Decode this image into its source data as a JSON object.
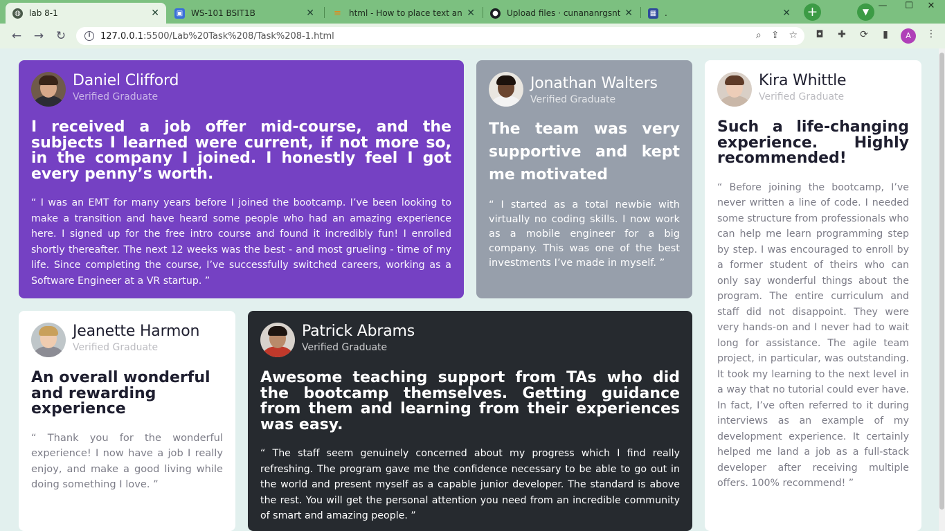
{
  "browser": {
    "tabs": [
      {
        "title": "lab 8-1",
        "active": true
      },
      {
        "title": "WS-101 BSIT1B"
      },
      {
        "title": "html - How to place text and"
      },
      {
        "title": "Upload files · cunananrgsnts"
      },
      {
        "title": "."
      }
    ],
    "new_tab_label": "+",
    "url_host": "127.0.0.1",
    "url_rest": ":5500/Lab%20Task%208/Task%208-1.html",
    "profile_initial": "A"
  },
  "testimonials": [
    {
      "name": "Daniel Clifford",
      "role": "Verified Graduate",
      "headline": "I received a job offer mid-course, and the subjects I learned were current, if not more so, in the company I joined. I honestly feel I got every penny’s worth.",
      "quote": "“ I was an EMT for many years before I joined the bootcamp. I’ve been looking to make a transition and have heard some people who had an amazing experience here. I signed up for the free intro course and found it incredibly fun! I enrolled shortly thereafter. The next 12 weeks was the best - and most grueling - time of my life. Since completing the course, I’ve successfully switched careers, working as a Software Engineer at a VR startup. ”"
    },
    {
      "name": "Jonathan Walters",
      "role": "Verified Graduate",
      "headline": "The team was very supportive and kept me motivated",
      "quote": "“ I started as a total newbie with virtually no coding skills. I now work as a mobile engineer for a big company. This was one of the best investments I’ve made in myself. ”"
    },
    {
      "name": "Kira Whittle",
      "role": "Verified Graduate",
      "headline": "Such a life-changing experience. Highly recommended!",
      "quote": "“ Before joining the bootcamp, I’ve never written a line of code. I needed some structure from professionals who can help me learn programming step by step. I was encouraged to enroll by a former student of theirs who can only say wonderful things about the program. The entire curriculum and staff did not disappoint. They were very hands-on and I never had to wait long for assistance. The agile team project, in particular, was outstanding. It took my learning to the next level in a way that no tutorial could ever have. In fact, I’ve often referred to it during interviews as an example of my development experience. It certainly helped me land a job as a full-stack developer after receiving multiple offers. 100% recommend! ”"
    },
    {
      "name": "Jeanette Harmon",
      "role": "Verified Graduate",
      "headline": "An overall wonderful and rewarding experience",
      "quote": "“ Thank you for the wonderful experience! I now have a job I really enjoy, and make a good living while doing something I love. ”"
    },
    {
      "name": "Patrick Abrams",
      "role": "Verified Graduate",
      "headline": "Awesome teaching support from TAs who did the bootcamp themselves. Getting guidance from them and learning from their experiences was easy.",
      "quote": "“ The staff seem genuinely concerned about my progress which I find really refreshing. The program gave me the confidence necessary to be able to go out in the world and present myself as a capable junior developer. The standard is above the rest. You will get the personal attention you need from an incredible community of smart and amazing people. ”"
    }
  ],
  "colors": {
    "purple": "#7541c3",
    "grey": "#979fab",
    "dark": "#262a2f",
    "white": "#ffffff",
    "page_bg": "#e2f0ee"
  }
}
